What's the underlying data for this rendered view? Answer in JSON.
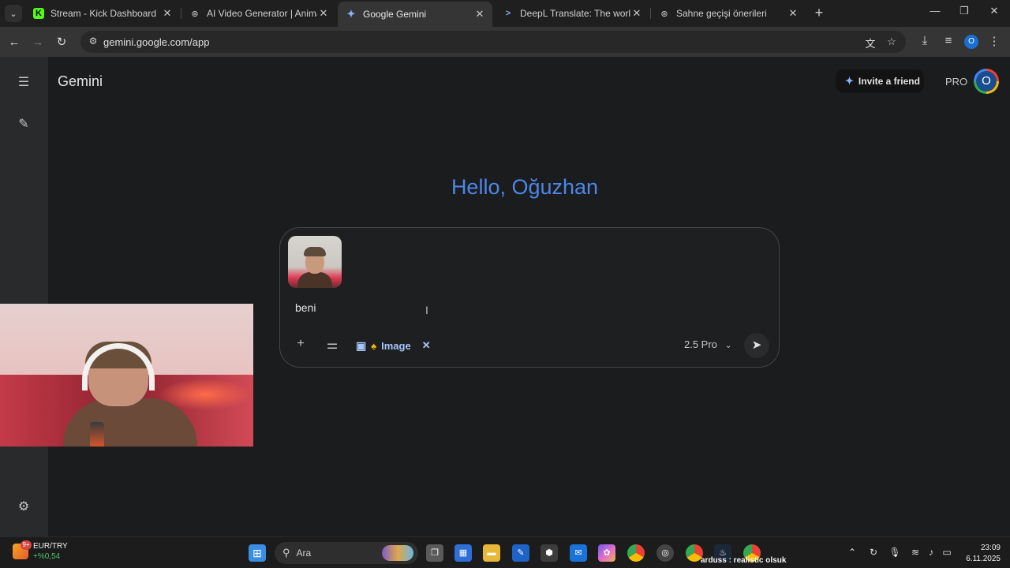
{
  "browser": {
    "tabs": [
      {
        "title": "Stream - Kick Dashboard",
        "favicon": "kick-icon",
        "active": false
      },
      {
        "title": "AI Video Generator | Animate Pictures",
        "favicon": "openai-icon",
        "active": false
      },
      {
        "title": "Google Gemini",
        "favicon": "gemini-icon",
        "active": true
      },
      {
        "title": "DeepL Translate: The world's most accurate translator",
        "favicon": "deepl-icon",
        "active": false
      },
      {
        "title": "Sahne geçişi önerileri",
        "favicon": "chatgpt-icon",
        "active": false
      }
    ],
    "url": "gemini.google.com/app",
    "profile_initial": "O"
  },
  "gemini": {
    "brand": "Gemini",
    "invite_label": "Invite a friend",
    "plan_badge": "PRO",
    "avatar_initial": "O",
    "greeting": "Hello, Oğuzhan",
    "prompt_text": "beni",
    "tool_chip_label": "Image",
    "model_label": "2.5 Pro",
    "accent": "#4d86e8"
  },
  "taskbar": {
    "widget_title": "EUR/TRY",
    "widget_value": "+%0,54",
    "widget_badge": "9+",
    "search_placeholder": "Ara",
    "now_playing": "arduss : realistic olsuk",
    "time": "23:09",
    "date": "6.11.2025"
  }
}
